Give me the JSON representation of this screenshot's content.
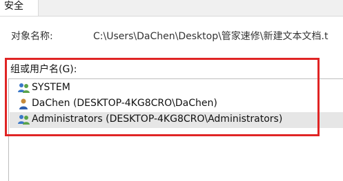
{
  "tab": {
    "label": "安全"
  },
  "object": {
    "label": "对象名称:",
    "path": "C:\\Users\\DaChen\\Desktop\\管家速修\\新建文本文档.t"
  },
  "group": {
    "label": "组或用户名(G):",
    "items": [
      {
        "name": "SYSTEM",
        "icon": "users-group-icon"
      },
      {
        "name": "DaChen (DESKTOP-4KG8CRO\\DaChen)",
        "icon": "user-icon"
      },
      {
        "name": "Administrators (DESKTOP-4KG8CRO\\Administrators)",
        "icon": "users-group-icon"
      }
    ]
  },
  "colors": {
    "highlight": "#e02424",
    "selected_row": "#e6e6e6"
  }
}
